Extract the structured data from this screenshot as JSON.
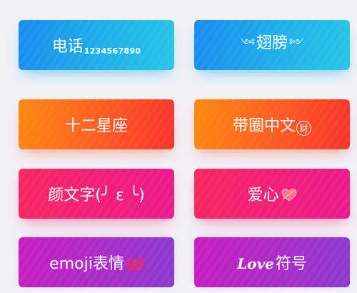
{
  "cards": {
    "phone": {
      "label": "电话",
      "digits": "1234567890"
    },
    "wings": {
      "left_deco": "༺",
      "label": "翅膀",
      "right_deco": "༻"
    },
    "zodiac": {
      "label": "十二星座"
    },
    "circled": {
      "label": "带圈中文",
      "circled_char": "财"
    },
    "kaomoji": {
      "label": "颜文字(╯ ε ╰)"
    },
    "heart": {
      "label": "爱心",
      "emoji": "💘"
    },
    "emoji": {
      "label": "emoji表情",
      "emoji": "💯"
    },
    "love": {
      "script": "Love",
      "label": "符号"
    }
  },
  "colors": {
    "background": "#f2f1f6",
    "blue": "#1fb0e9",
    "orange": "#ff5a22",
    "pink": "#f11f79",
    "purple": "#a92dc8",
    "text": "#ffffff"
  }
}
